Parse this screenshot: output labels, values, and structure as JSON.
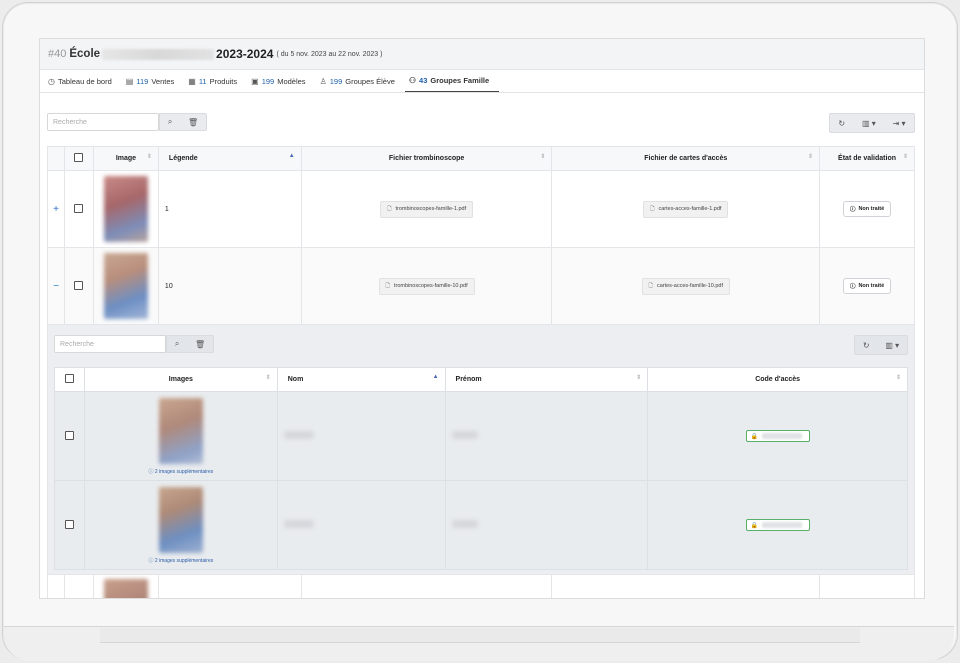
{
  "header": {
    "id": "#40",
    "school": "École",
    "year": "2023-2024",
    "dates": "( du 5 nov. 2023 au 22 nov. 2023 )"
  },
  "tabs": [
    {
      "label": "Tableau de bord",
      "count": "",
      "icon": "dashboard-icon"
    },
    {
      "label": "Ventes",
      "count": "119",
      "icon": "receipt-icon"
    },
    {
      "label": "Produits",
      "count": "11",
      "icon": "products-icon"
    },
    {
      "label": "Modèles",
      "count": "199",
      "icon": "template-icon"
    },
    {
      "label": "Groupes Élève",
      "count": "199",
      "icon": "user-icon"
    },
    {
      "label": "Groupes Famille",
      "count": "43",
      "icon": "family-icon"
    }
  ],
  "search": {
    "placeholder": "Recherche"
  },
  "main_table": {
    "columns": [
      "Image",
      "Légende",
      "Fichier trombinoscope",
      "Fichier de cartes d'accès",
      "État de validation"
    ],
    "rows": [
      {
        "expander": "+",
        "legend": "1",
        "trombi": "trombinoscopes-famille-1.pdf",
        "cards": "cartes-acces-famille-1.pdf",
        "status": "Non traité"
      },
      {
        "expander": "−",
        "legend": "10",
        "trombi": "trombinoscopes-famille-10.pdf",
        "cards": "cartes-acces-famille-10.pdf",
        "status": "Non traité"
      }
    ]
  },
  "sub_table": {
    "search_placeholder": "Recherche",
    "columns": [
      "Images",
      "Nom",
      "Prénom",
      "Code d'accès"
    ],
    "rows": [
      {
        "more": "2 images supplémentaires"
      },
      {
        "more": "2 images supplémentaires"
      }
    ]
  },
  "colors": {
    "accent": "#2c73c9",
    "success": "#57b06a",
    "sort_active": "#4a64b6"
  }
}
